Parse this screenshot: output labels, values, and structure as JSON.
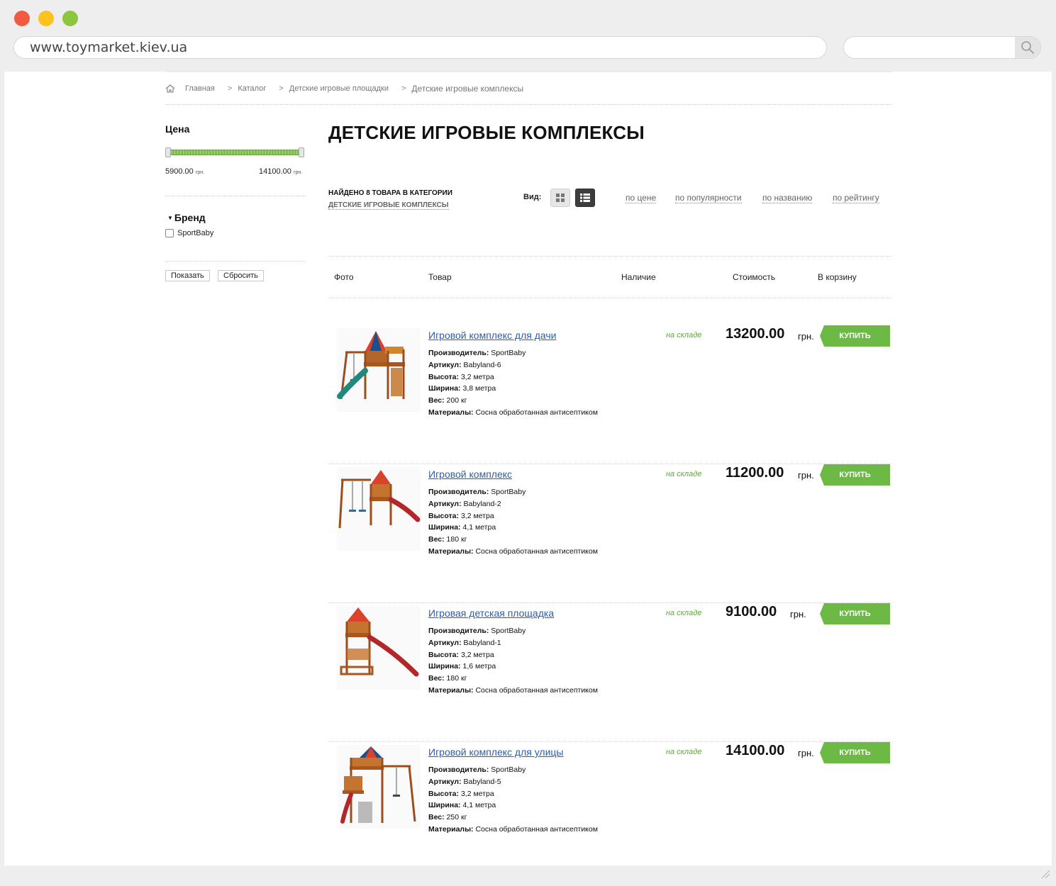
{
  "browser": {
    "url": "www.toymarket.kiev.ua",
    "dot_colors": [
      "#f05a3f",
      "#fbc31c",
      "#8cc63f"
    ]
  },
  "breadcrumb": {
    "home": "Главная",
    "sep": ">",
    "items": [
      "Каталог",
      "Детские игровые площадки"
    ],
    "current": "Детские игровые комплексы"
  },
  "sidebar": {
    "price_title": "Цена",
    "price_min": "5900.00",
    "price_max": "14100.00",
    "currency_small": "грн.",
    "brand_title": "Бренд",
    "brand_option": "SportBaby",
    "brand_checked": false,
    "show_label": "Показать",
    "reset_label": "Сбросить"
  },
  "main": {
    "title": "ДЕТСКИЕ ИГРОВЫЕ КОМПЛЕКСЫ",
    "found_text": "НАЙДЕНО 8 ТОВАРА В КАТЕГОРИИ",
    "found_category": "ДЕТСКИЕ ИГРОВЫЕ КОМПЛЕКСЫ",
    "view_label": "Вид:",
    "sort": [
      "по цене",
      "по популярности",
      "по названию",
      "по рейтингу"
    ]
  },
  "table": {
    "headers": [
      "Фото",
      "Товар",
      "Наличие",
      "Стоимость",
      "В корзину"
    ]
  },
  "spec_labels": {
    "maker": "Производитель:",
    "article": "Артикул:",
    "height": "Высота:",
    "width": "Ширина:",
    "weight": "Вес:",
    "material": "Материалы:"
  },
  "stock_label": "на складе",
  "currency": "грн.",
  "buy_label": "КУПИТЬ",
  "products": [
    {
      "name": "Игровой комплекс для дачи",
      "maker": "SportBaby",
      "article": "Babyland-6",
      "height": "3,2 метра",
      "width": "3,8 метра",
      "weight": "200 кг",
      "material": "Сосна обработанная антисептиком",
      "price": "13200.00"
    },
    {
      "name": "Игровой комплекс",
      "maker": "SportBaby",
      "article": "Babyland-2",
      "height": "3,2 метра",
      "width": "4,1 метра",
      "weight": "180 кг",
      "material": "Сосна обработанная антисептиком",
      "price": "11200.00"
    },
    {
      "name": "Игровая детская площадка",
      "maker": "SportBaby",
      "article": "Babyland-1",
      "height": "3,2 метра",
      "width": "1,6 метра",
      "weight": "180 кг",
      "material": "Сосна обработанная антисептиком",
      "price": "9100.00"
    },
    {
      "name": "Игровой комплекс для улицы",
      "maker": "SportBaby",
      "article": "Babyland-5",
      "height": "3,2 метра",
      "width": "4,1 метра",
      "weight": "250 кг",
      "material": "Сосна обработанная антисептиком",
      "price": "14100.00"
    }
  ]
}
